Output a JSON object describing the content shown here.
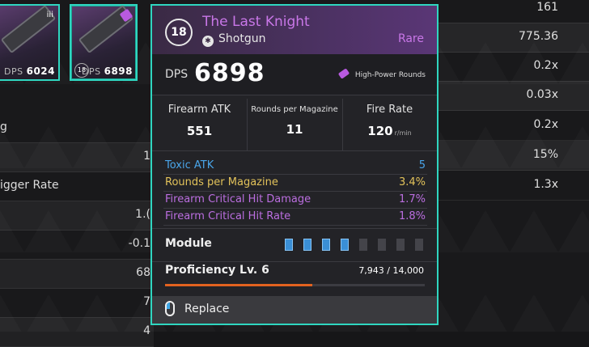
{
  "weapon_cards": [
    {
      "dps_label": "DPS",
      "dps_value": "6024",
      "tag": "iii"
    },
    {
      "dps_label": "DPS",
      "dps_value": "6898",
      "level": "18",
      "magazine_icon": "high-power-rounds-icon"
    }
  ],
  "left_stats": [
    {
      "label": "g",
      "value": ""
    },
    {
      "label": "",
      "value": "1"
    },
    {
      "label": "igger Rate",
      "value": ""
    },
    {
      "label": "",
      "value": "1.("
    },
    {
      "label": "",
      "value": "-0.1"
    },
    {
      "label": "",
      "value": "68"
    },
    {
      "label": "",
      "value": "7"
    },
    {
      "label": "",
      "value": "4"
    }
  ],
  "right_stats": [
    "161",
    "775.36",
    "0.2x",
    "0.03x",
    "0.2x",
    "15%",
    "1.3x"
  ],
  "tooltip": {
    "level": "18",
    "name": "The Last Knight",
    "type": "Shotgun",
    "rarity": "Rare",
    "dps_label": "DPS",
    "dps_value": "6898",
    "ammo_type": "High-Power Rounds",
    "main_stats": [
      {
        "label": "Firearm ATK",
        "value": "551",
        "unit": ""
      },
      {
        "label": "Rounds per Magazine",
        "value": "11",
        "unit": ""
      },
      {
        "label": "Fire Rate",
        "value": "120",
        "unit": "r/min"
      }
    ],
    "sub_stats": [
      {
        "label": "Toxic ATK",
        "value": "5",
        "color": "#4aa6ea"
      },
      {
        "label": "Rounds per Magazine",
        "value": "3.4%",
        "color": "#e2c25a"
      },
      {
        "label": "Firearm Critical Hit Damage",
        "value": "1.7%",
        "color": "#bb6ee0"
      },
      {
        "label": "Firearm Critical Hit Rate",
        "value": "1.8%",
        "color": "#bb6ee0"
      }
    ],
    "module_label": "Module",
    "module_slots_filled": 4,
    "module_slots_total": 8,
    "proficiency_label": "Proficiency Lv. 6",
    "proficiency_value": "7,943 / 14,000",
    "proficiency_fraction": 0.567,
    "replace_label": "Replace"
  },
  "colors": {
    "accent": "#2fd6c0",
    "rare": "#c977e8",
    "progress": "#e2621f"
  }
}
